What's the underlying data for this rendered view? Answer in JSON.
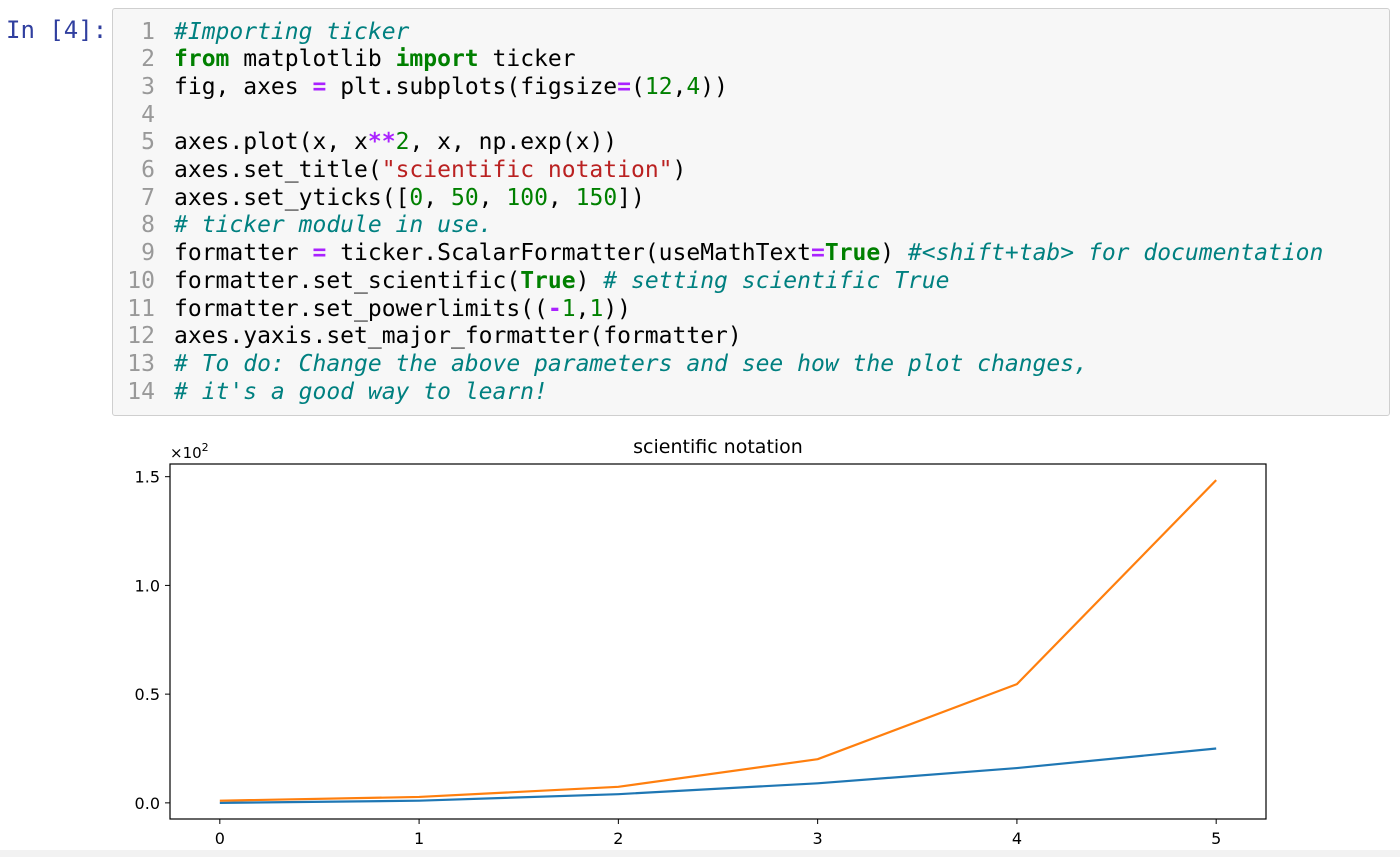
{
  "cell": {
    "prompt": "In [4]:",
    "lines": [
      [
        {
          "t": "comment",
          "v": "#Importing ticker"
        }
      ],
      [
        {
          "t": "kw",
          "v": "from"
        },
        {
          "t": "text",
          "v": " matplotlib "
        },
        {
          "t": "kw",
          "v": "import"
        },
        {
          "t": "text",
          "v": " ticker"
        }
      ],
      [
        {
          "t": "text",
          "v": "fig, axes "
        },
        {
          "t": "op",
          "v": "="
        },
        {
          "t": "text",
          "v": " plt.subplots(figsize"
        },
        {
          "t": "op",
          "v": "="
        },
        {
          "t": "text",
          "v": "("
        },
        {
          "t": "num",
          "v": "12"
        },
        {
          "t": "text",
          "v": ","
        },
        {
          "t": "num",
          "v": "4"
        },
        {
          "t": "text",
          "v": "))"
        }
      ],
      [],
      [
        {
          "t": "text",
          "v": "axes.plot(x, x"
        },
        {
          "t": "op",
          "v": "**"
        },
        {
          "t": "num",
          "v": "2"
        },
        {
          "t": "text",
          "v": ", x, np.exp(x))"
        }
      ],
      [
        {
          "t": "text",
          "v": "axes.set_title("
        },
        {
          "t": "str",
          "v": "\"scientific notation\""
        },
        {
          "t": "text",
          "v": ")"
        }
      ],
      [
        {
          "t": "text",
          "v": "axes.set_yticks(["
        },
        {
          "t": "num",
          "v": "0"
        },
        {
          "t": "text",
          "v": ", "
        },
        {
          "t": "num",
          "v": "50"
        },
        {
          "t": "text",
          "v": ", "
        },
        {
          "t": "num",
          "v": "100"
        },
        {
          "t": "text",
          "v": ", "
        },
        {
          "t": "num",
          "v": "150"
        },
        {
          "t": "text",
          "v": "])"
        }
      ],
      [
        {
          "t": "comment",
          "v": "# ticker module in use."
        }
      ],
      [
        {
          "t": "text",
          "v": "formatter "
        },
        {
          "t": "op",
          "v": "="
        },
        {
          "t": "text",
          "v": " ticker.ScalarFormatter(useMathText"
        },
        {
          "t": "op",
          "v": "="
        },
        {
          "t": "kw",
          "v": "True"
        },
        {
          "t": "text",
          "v": ") "
        },
        {
          "t": "comment",
          "v": "#<shift+tab> for documentation"
        }
      ],
      [
        {
          "t": "text",
          "v": "formatter.set_scientific("
        },
        {
          "t": "kw",
          "v": "True"
        },
        {
          "t": "text",
          "v": ") "
        },
        {
          "t": "comment",
          "v": "# setting scientific True"
        }
      ],
      [
        {
          "t": "text",
          "v": "formatter.set_powerlimits(("
        },
        {
          "t": "op",
          "v": "-"
        },
        {
          "t": "num",
          "v": "1"
        },
        {
          "t": "text",
          "v": ","
        },
        {
          "t": "num",
          "v": "1"
        },
        {
          "t": "text",
          "v": "))"
        }
      ],
      [
        {
          "t": "text",
          "v": "axes.yaxis.set_major_formatter(formatter)"
        }
      ],
      [
        {
          "t": "comment",
          "v": "# To do: Change the above parameters and see how the plot changes,"
        }
      ],
      [
        {
          "t": "comment",
          "v": "# it's a good way to learn!"
        }
      ]
    ]
  },
  "chart_data": {
    "type": "line",
    "title": "scientific notation",
    "xlabel": "",
    "ylabel": "",
    "y_offset_label": "×10",
    "y_offset_exponent": "2",
    "x": [
      0,
      1,
      2,
      3,
      4,
      5
    ],
    "series": [
      {
        "values": [
          0,
          1,
          4,
          9,
          16,
          25
        ],
        "color": "#1f77b4"
      },
      {
        "values": [
          1,
          2.718,
          7.389,
          20.086,
          54.598,
          148.413
        ],
        "color": "#ff7f0e"
      }
    ],
    "xlim": [
      -0.25,
      5.25
    ],
    "ylim": [
      -7.42,
      155.83
    ],
    "xticks": [
      0,
      1,
      2,
      3,
      4,
      5
    ],
    "xtick_labels": [
      "0",
      "1",
      "2",
      "3",
      "4",
      "5"
    ],
    "yticks": [
      0,
      50,
      100,
      150
    ],
    "ytick_labels": [
      "0.0",
      "0.5",
      "1.0",
      "1.5"
    ],
    "grid": false
  }
}
